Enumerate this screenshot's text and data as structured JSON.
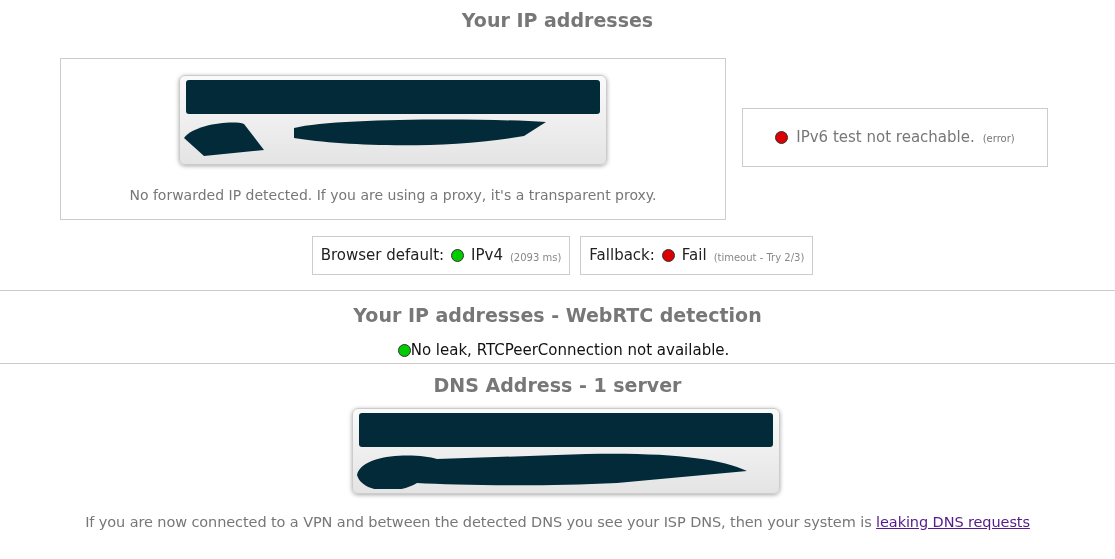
{
  "ip_section": {
    "title": "Your IP addresses",
    "note": "No forwarded IP detected. If you are using a proxy, it's a transparent proxy.",
    "ipv6_status": {
      "text": "IPv6 test not reachable.",
      "detail": "(error)",
      "color": "#dd0000"
    },
    "protocol_tests": [
      {
        "label": "Browser default:",
        "result": "IPv4",
        "detail": "(2093 ms)",
        "color": "#00cc00"
      },
      {
        "label": "Fallback:",
        "result": "Fail",
        "detail": "(timeout - Try 2/3)",
        "color": "#dd0000"
      }
    ]
  },
  "webrtc_section": {
    "title": "Your IP addresses - WebRTC detection",
    "status": {
      "text": "No leak, RTCPeerConnection not available.",
      "color": "#00cc00"
    }
  },
  "dns_section": {
    "title": "DNS Address - 1 server",
    "footer": {
      "text": "If you are now connected to a VPN and between the detected DNS you see your ISP DNS, then your system is",
      "link": "leaking DNS requests"
    }
  }
}
